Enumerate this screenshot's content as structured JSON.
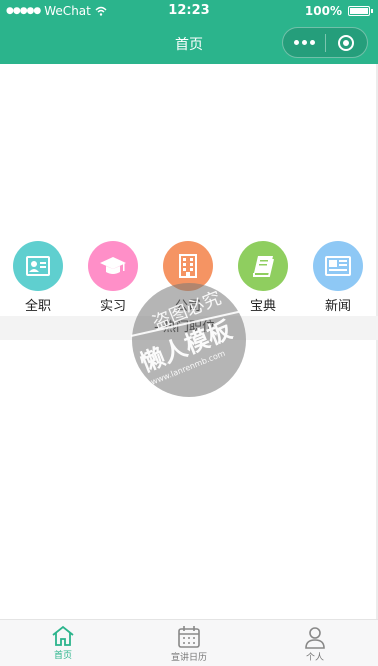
{
  "status_bar": {
    "carrier": "WeChat",
    "time": "12:23",
    "battery": "100%",
    "battery_level": 1.0
  },
  "nav": {
    "title": "首页"
  },
  "categories": [
    {
      "label": "全职",
      "icon": "id-card-icon",
      "color": "#5fcfcf"
    },
    {
      "label": "实习",
      "icon": "graduation-cap-icon",
      "color": "#ff8fc8"
    },
    {
      "label": "公司",
      "icon": "building-icon",
      "color": "#f59463"
    },
    {
      "label": "宝典",
      "icon": "book-icon",
      "color": "#8fce5f"
    },
    {
      "label": "新闻",
      "icon": "newspaper-icon",
      "color": "#8ec8f5"
    }
  ],
  "hot_section": {
    "title": "- 热门职位 -"
  },
  "watermark": {
    "line1": "盗图必究",
    "line2": "懒人模板",
    "line3": "www.lanrenmb.com"
  },
  "tabbar": {
    "items": [
      {
        "label": "首页",
        "icon": "home-icon",
        "active": true
      },
      {
        "label": "宣讲日历",
        "icon": "calendar-icon",
        "active": false
      },
      {
        "label": "个人",
        "icon": "person-icon",
        "active": false
      }
    ],
    "active_color": "#2bb48c"
  },
  "theme": {
    "primary": "#2bb48c"
  }
}
